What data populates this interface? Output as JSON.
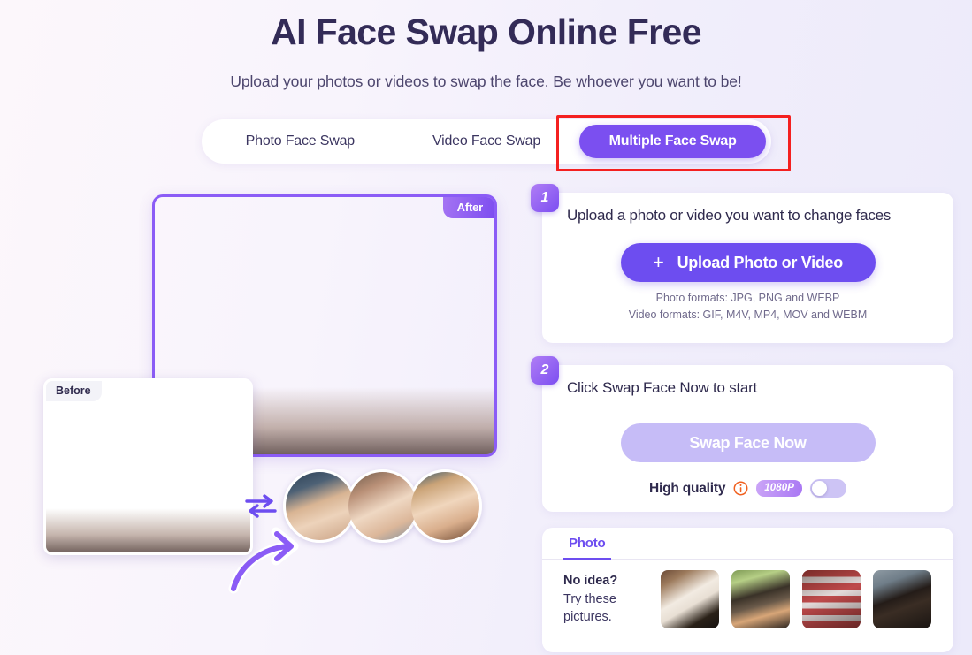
{
  "header": {
    "title": "AI Face Swap Online Free",
    "subtitle": "Upload your photos or videos to swap the face. Be whoever you want to be!"
  },
  "tabs": [
    {
      "label": "Photo Face Swap",
      "active": false
    },
    {
      "label": "Video Face Swap",
      "active": false
    },
    {
      "label": "Multiple Face Swap",
      "active": true
    }
  ],
  "annotation": {
    "type": "red-rectangle-highlight",
    "target": "Multiple Face Swap",
    "color": "#f42020"
  },
  "preview": {
    "after_badge": "After",
    "before_badge": "Before",
    "swap_icon": "swap-arrows-icon",
    "arrow_icon": "curved-arrow-icon",
    "face_thumbnails": [
      "face-option-1",
      "face-option-2",
      "face-option-3"
    ]
  },
  "steps": {
    "upload": {
      "number": "1",
      "heading": "Upload a photo or video you want to change faces",
      "button_label": "Upload Photo or Video",
      "plus_icon": "+",
      "photo_formats": "Photo formats: JPG, PNG and WEBP",
      "video_formats": "Video formats: GIF, M4V, MP4, MOV and WEBM"
    },
    "swap": {
      "number": "2",
      "heading": "Click Swap Face Now to start",
      "button_label": "Swap Face Now",
      "quality_label": "High quality",
      "quality_badge": "1080P",
      "toggle_state": "off"
    }
  },
  "samples": {
    "tab_label": "Photo",
    "prompt_bold": "No idea?",
    "prompt_line2": "Try these",
    "prompt_line3": "pictures.",
    "thumbnails": [
      "sample-wedding-couple",
      "sample-friends-group",
      "sample-flag-couple",
      "sample-wizard-trio"
    ]
  },
  "colors": {
    "accent": "#6d4df0",
    "accent_active_tab": "#7b4ff0",
    "accent_disabled": "#c6bcf7",
    "title": "#332b57",
    "highlight_box": "#f42020",
    "info_icon": "#f0601f"
  }
}
